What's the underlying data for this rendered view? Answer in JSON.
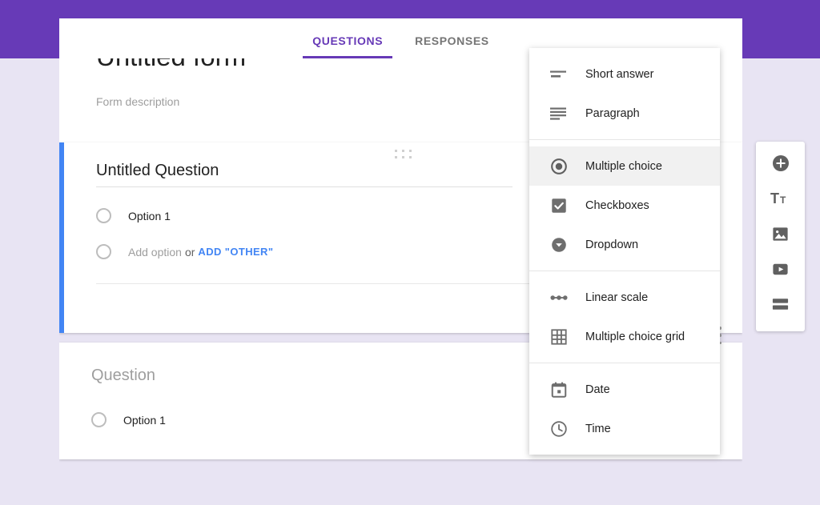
{
  "theme": {
    "banner_color": "#673ab7",
    "accent_color": "#4285f4",
    "page_background": "#e8e4f3",
    "active_tab_color": "#673ab7"
  },
  "tabs": [
    {
      "label": "QUESTIONS",
      "active": true
    },
    {
      "label": "RESPONSES",
      "active": false
    }
  ],
  "form": {
    "title": "Untitled form",
    "description": "Form description"
  },
  "questions": [
    {
      "title": "Untitled Question",
      "title_is_placeholder": false,
      "options": [
        "Option 1"
      ],
      "add_option_label": "Add option",
      "or_label": "or",
      "add_other_label": "ADD \"OTHER\"",
      "duplicate_icon": "duplicate-icon",
      "active": true
    },
    {
      "title": "Question",
      "title_is_placeholder": true,
      "options": [
        "Option 1"
      ],
      "active": false
    }
  ],
  "side_toolbar": {
    "items": [
      {
        "name": "add-question-button",
        "icon": "add-circle-icon"
      },
      {
        "name": "add-title-button",
        "icon": "text-format-icon"
      },
      {
        "name": "add-image-button",
        "icon": "image-icon"
      },
      {
        "name": "add-video-button",
        "icon": "video-icon"
      },
      {
        "name": "add-section-button",
        "icon": "section-icon"
      }
    ]
  },
  "type_menu": {
    "groups": [
      {
        "items": [
          {
            "label": "Short answer",
            "icon": "short-answer-icon",
            "selected": false
          },
          {
            "label": "Paragraph",
            "icon": "paragraph-icon",
            "selected": false
          }
        ]
      },
      {
        "items": [
          {
            "label": "Multiple choice",
            "icon": "radio-button-icon",
            "selected": true
          },
          {
            "label": "Checkboxes",
            "icon": "checkbox-icon",
            "selected": false
          },
          {
            "label": "Dropdown",
            "icon": "dropdown-icon",
            "selected": false
          }
        ]
      },
      {
        "items": [
          {
            "label": "Linear scale",
            "icon": "linear-scale-icon",
            "selected": false
          },
          {
            "label": "Multiple choice grid",
            "icon": "grid-icon",
            "selected": false
          }
        ]
      },
      {
        "items": [
          {
            "label": "Date",
            "icon": "calendar-icon",
            "selected": false
          },
          {
            "label": "Time",
            "icon": "clock-icon",
            "selected": false
          }
        ]
      }
    ]
  }
}
